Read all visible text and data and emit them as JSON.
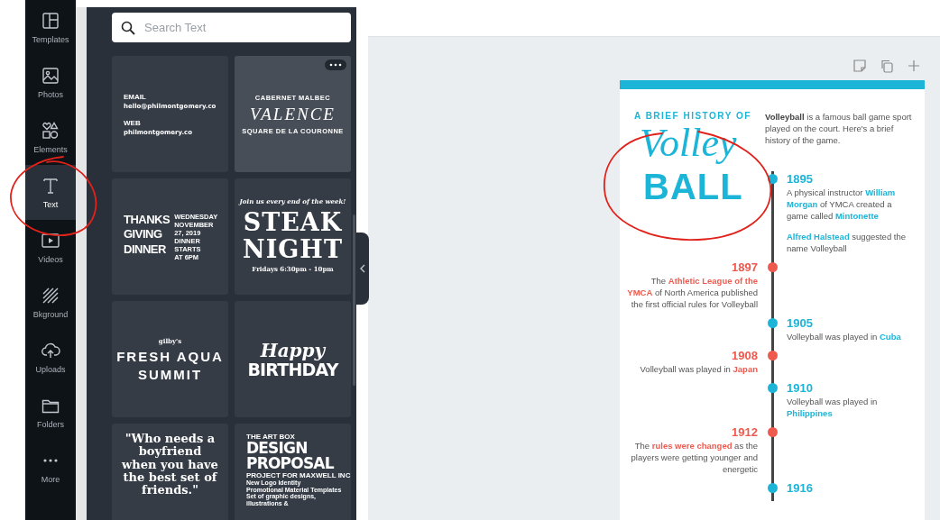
{
  "sidebar": {
    "items": [
      {
        "label": "Templates",
        "selected": false
      },
      {
        "label": "Photos",
        "selected": false
      },
      {
        "label": "Elements",
        "selected": false
      },
      {
        "label": "Text",
        "selected": true
      },
      {
        "label": "Videos",
        "selected": false
      },
      {
        "label": "Bkground",
        "selected": false
      },
      {
        "label": "Uploads",
        "selected": false
      },
      {
        "label": "Folders",
        "selected": false
      },
      {
        "label": "More",
        "selected": false
      }
    ]
  },
  "text_panel": {
    "search": {
      "placeholder": "Search Text"
    },
    "cards": [
      {
        "kind": "left",
        "hovered": false,
        "blocks": [
          [
            {
              "text": "EMAIL",
              "kind": "label"
            },
            {
              "text": "hello@philmontgomery.co",
              "kind": "small"
            }
          ],
          [
            {
              "text": "WEB",
              "kind": "label"
            },
            {
              "text": "philmontgomery.co",
              "kind": "small"
            }
          ]
        ]
      },
      {
        "kind": "center",
        "hovered": true,
        "blocks": [
          [
            {
              "text": "CABERNET MALBEC",
              "kind": "tiny"
            },
            {
              "text": "VALENCE",
              "kind": "serif-italic"
            },
            {
              "text": "SQUARE DE LA COURONNE",
              "kind": "tiny"
            }
          ]
        ]
      },
      {
        "kind": "split",
        "hovered": false,
        "blocks": [
          [
            {
              "text": "THANKS",
              "kind": "condensed"
            },
            {
              "text": "GIVING",
              "kind": "condensed"
            },
            {
              "text": "DINNER",
              "kind": "condensed"
            }
          ],
          [
            {
              "text": "WEDNESDAY",
              "kind": "tiny"
            },
            {
              "text": "NOVEMBER 27, 2019",
              "kind": "tiny"
            },
            {
              "text": "DINNER STARTS",
              "kind": "tiny"
            },
            {
              "text": "AT 6PM",
              "kind": "tiny"
            }
          ]
        ]
      },
      {
        "kind": "center",
        "hovered": false,
        "blocks": [
          [
            {
              "text": "Join us every end of the week!",
              "kind": "script-small"
            },
            {
              "text": "STEAK",
              "kind": "slab"
            },
            {
              "text": "NIGHT",
              "kind": "slab"
            },
            {
              "text": "Fridays 6:30pm - 10pm",
              "kind": "serif-small"
            }
          ]
        ]
      },
      {
        "kind": "center",
        "hovered": false,
        "blocks": [
          [
            {
              "text": "gilby's",
              "kind": "serif-small"
            },
            {
              "text": "FRESH AQUA",
              "kind": "spaced"
            },
            {
              "text": "SUMMIT",
              "kind": "spaced"
            }
          ]
        ]
      },
      {
        "kind": "center",
        "hovered": false,
        "blocks": [
          [
            {
              "text": "Happy",
              "kind": "script"
            },
            {
              "text": "BIRTHDAY",
              "kind": "heavy"
            }
          ]
        ]
      },
      {
        "kind": "center",
        "hovered": false,
        "blocks": [
          [
            {
              "text": "\"Who needs a boyfriend when you have the best set of friends.\"",
              "kind": "quote"
            }
          ]
        ]
      },
      {
        "kind": "left",
        "hovered": false,
        "blocks": [
          [
            {
              "text": "THE ART BOX",
              "kind": "label"
            },
            {
              "text": "DESIGN",
              "kind": "heavy"
            },
            {
              "text": "PROPOSAL",
              "kind": "heavy"
            },
            {
              "text": "PROJECT FOR MAXWELL INC",
              "kind": "label"
            },
            {
              "text": "New Logo Identity",
              "kind": "tiny-left"
            },
            {
              "text": "Promotional Material Templates",
              "kind": "tiny-left"
            },
            {
              "text": "Set of graphic designs, illustrations &",
              "kind": "tiny-left"
            }
          ]
        ]
      }
    ]
  },
  "document": {
    "kicker": "A BRIEF HISTORY OF",
    "script_title": "Volley",
    "title": "BALL",
    "intro": "**Volleyball** is a famous ball game sport played on the court. Here's a brief history of the game.",
    "events": [
      {
        "year": "1895",
        "kind": "right",
        "color": "#1cb5d8",
        "paragraphs": [
          "A physical instructor **William Morgan** of YMCA created a game called **Mintonette**",
          "**Alfred Halstead** suggested the name Volleyball"
        ]
      },
      {
        "year": "1897",
        "kind": "left",
        "color": "#ef5a4e",
        "paragraphs": [
          "The **Athletic League of the YMCA** of North America published the first official rules for Volleyball"
        ]
      },
      {
        "year": "1905",
        "kind": "right",
        "color": "#1cb5d8",
        "paragraphs": [
          "Volleyball was played in **Cuba**"
        ]
      },
      {
        "year": "1908",
        "kind": "left",
        "color": "#ef5a4e",
        "paragraphs": [
          "Volleyball was played in **Japan**"
        ]
      },
      {
        "year": "1910",
        "kind": "right",
        "color": "#1cb5d8",
        "paragraphs": [
          "Volleyball was played in **Philippines**"
        ]
      },
      {
        "year": "1912",
        "kind": "left",
        "color": "#ef5a4e",
        "paragraphs": [
          "The **rules were changed** as the players were getting younger and energetic"
        ]
      },
      {
        "year": "1916",
        "kind": "right",
        "color": "#1cb5d8"
      }
    ]
  }
}
